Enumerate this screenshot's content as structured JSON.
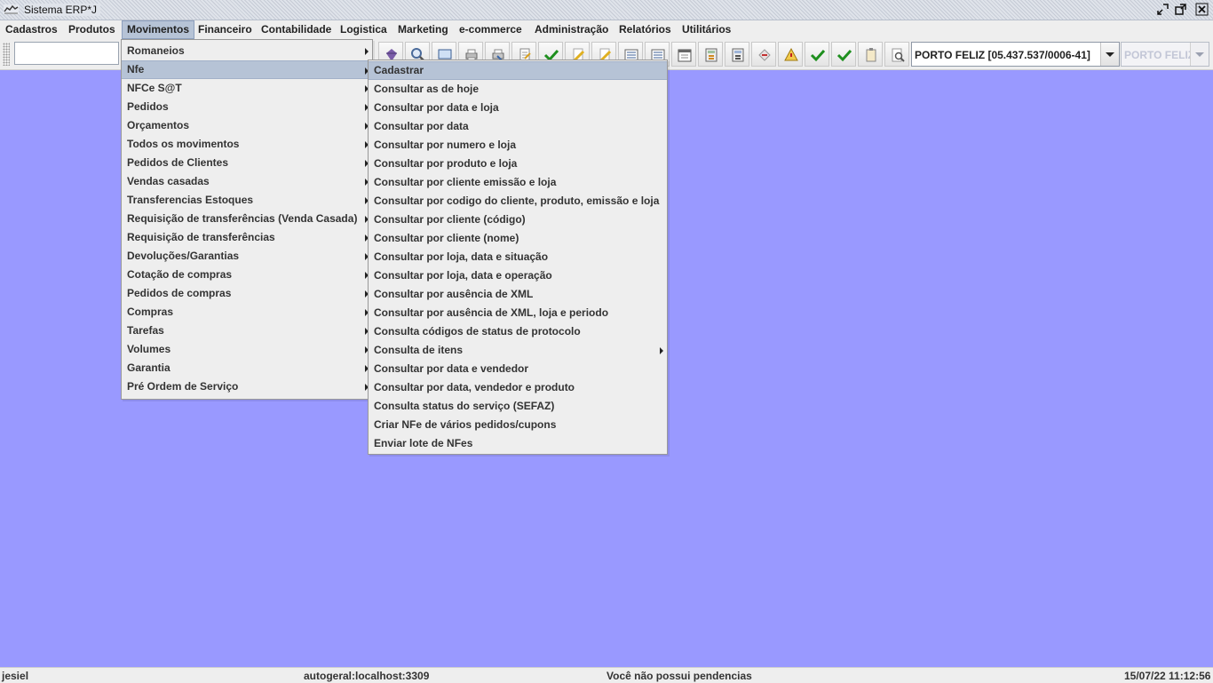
{
  "window": {
    "title": "Sistema ERP*J"
  },
  "menubar": {
    "items": [
      {
        "label": "Cadastros"
      },
      {
        "label": "Produtos"
      },
      {
        "label": "Movimentos"
      },
      {
        "label": "Financeiro"
      },
      {
        "label": "Contabilidade"
      },
      {
        "label": "Logistica"
      },
      {
        "label": "Marketing"
      },
      {
        "label": "e-commerce"
      },
      {
        "label": "Administração"
      },
      {
        "label": "Relatórios"
      },
      {
        "label": "Utilitários"
      }
    ],
    "active": "Movimentos"
  },
  "toolbar": {
    "search_value": "",
    "company": "PORTO FELIZ [05.437.537/0006-41]",
    "store": "PORTO FELIZ",
    "icons": [
      "purple-gem-icon",
      "magnifier-icon",
      "monitor-icon",
      "printer-icon",
      "printer-icon",
      "document-icon",
      "green-check-icon",
      "yellow-pen-icon",
      "yellow-pen-icon",
      "list-icon",
      "list-icon",
      "calendar-icon",
      "calculator-icon",
      "calculator-icon",
      "document-red-icon",
      "warning-sign-icon",
      "green-check-icon",
      "green-check-icon",
      "clipboard-icon",
      "search-document-icon"
    ]
  },
  "movimentos_menu": {
    "items": [
      {
        "label": "Romaneios",
        "submenu": true
      },
      {
        "label": "Nfe",
        "submenu": true
      },
      {
        "label": "NFCe S@T",
        "submenu": true
      },
      {
        "label": "Pedidos",
        "submenu": true
      },
      {
        "label": "Orçamentos",
        "submenu": true
      },
      {
        "label": "Todos os movimentos",
        "submenu": true
      },
      {
        "label": "Pedidos de Clientes",
        "submenu": true
      },
      {
        "label": "Vendas casadas",
        "submenu": true
      },
      {
        "label": "Transferencias Estoques",
        "submenu": true
      },
      {
        "label": "Requisição de transferências (Venda Casada)",
        "submenu": true
      },
      {
        "label": "Requisição de transferências",
        "submenu": true
      },
      {
        "label": "Devoluções/Garantias",
        "submenu": true
      },
      {
        "label": "Cotação de compras",
        "submenu": true
      },
      {
        "label": "Pedidos de compras",
        "submenu": true
      },
      {
        "label": "Compras",
        "submenu": true
      },
      {
        "label": "Tarefas",
        "submenu": true
      },
      {
        "label": "Volumes",
        "submenu": true
      },
      {
        "label": "Garantia",
        "submenu": true
      },
      {
        "label": "Pré Ordem de Serviço",
        "submenu": true
      }
    ],
    "highlighted": "Nfe"
  },
  "nfe_menu": {
    "items": [
      {
        "label": "Cadastrar"
      },
      {
        "label": "Consultar as de hoje"
      },
      {
        "label": "Consultar por data e loja"
      },
      {
        "label": "Consultar por data"
      },
      {
        "label": "Consultar por numero e loja"
      },
      {
        "label": "Consultar por produto e loja"
      },
      {
        "label": "Consultar por cliente emissão e loja"
      },
      {
        "label": "Consultar por codigo do cliente, produto, emissão e loja"
      },
      {
        "label": "Consultar por cliente (código)"
      },
      {
        "label": "Consultar por cliente (nome)"
      },
      {
        "label": "Consultar por loja, data e situação"
      },
      {
        "label": "Consultar por loja, data e operação"
      },
      {
        "label": "Consultar por ausência de XML"
      },
      {
        "label": "Consultar por ausência de XML, loja e periodo"
      },
      {
        "label": "Consulta códigos de status de protocolo"
      },
      {
        "label": "Consulta de itens",
        "submenu": true
      },
      {
        "label": "Consultar por data e vendedor"
      },
      {
        "label": "Consultar por data, vendedor e produto"
      },
      {
        "label": "Consulta status do serviço (SEFAZ)"
      },
      {
        "label": "Criar NFe de vários pedidos/cupons"
      },
      {
        "label": "Enviar lote de NFes"
      }
    ],
    "highlighted": "Cadastrar"
  },
  "statusbar": {
    "user": "jesiel",
    "connection": "autogeral:localhost:3309",
    "pending": "Você não possui pendencias",
    "datetime": "15/07/22 11:12:56"
  },
  "colors": {
    "desktop": "#9999ff",
    "menu_bg": "#eeeeee",
    "highlight": "#b6c3d6"
  }
}
